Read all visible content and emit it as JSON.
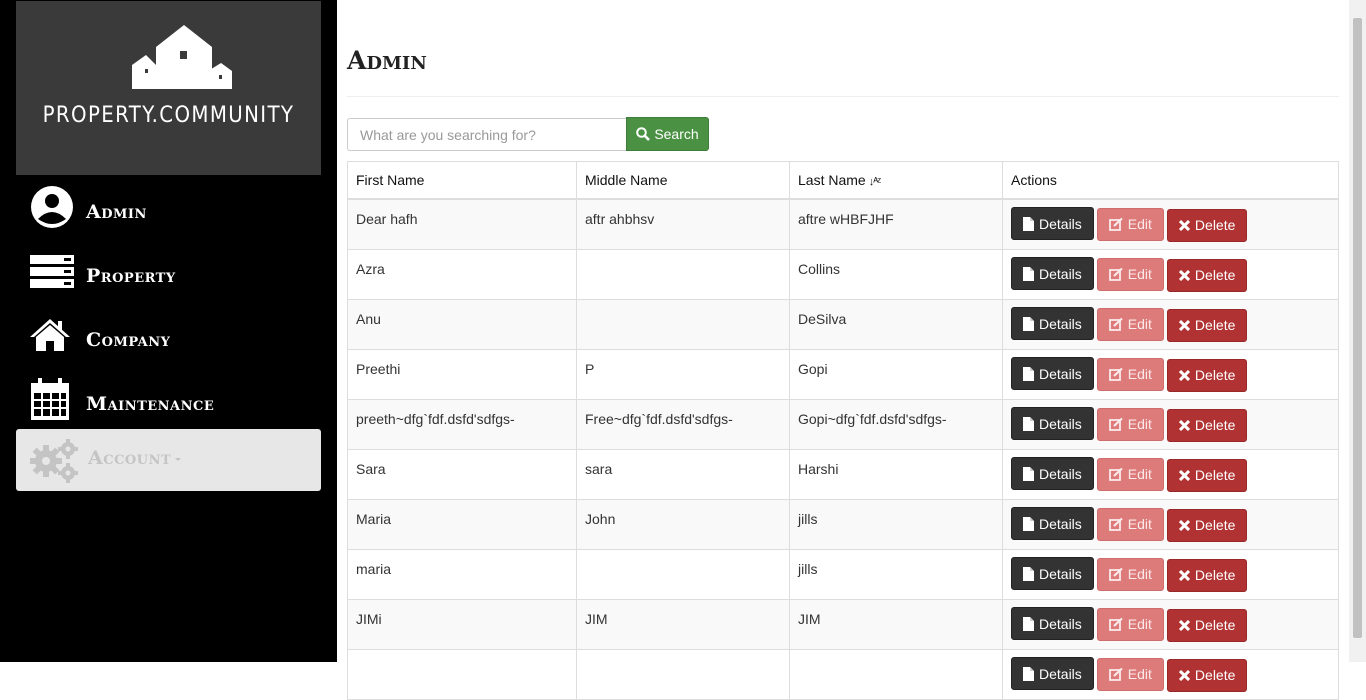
{
  "brand": {
    "logo_text": "PROPERTY.COMMUNITY"
  },
  "nav": {
    "items": [
      {
        "label": "Admin",
        "icon": "user-circle-icon"
      },
      {
        "label": "Property",
        "icon": "server-icon"
      },
      {
        "label": "Company",
        "icon": "home-icon"
      },
      {
        "label": "Maintenance",
        "icon": "calendar-icon"
      }
    ],
    "account": {
      "label": "Account",
      "icon": "gears-icon"
    }
  },
  "page": {
    "title": "Admin"
  },
  "search": {
    "placeholder": "What are you searching for?",
    "button_label": "Search"
  },
  "table": {
    "columns": [
      "First Name",
      "Middle Name",
      "Last Name",
      "Actions"
    ],
    "sort_column": "Last Name",
    "action_labels": {
      "details": "Details",
      "edit": "Edit",
      "delete": "Delete"
    },
    "rows": [
      {
        "first": "Dear hafh",
        "middle": "aftr ahbhsv",
        "last": "aftre wHBFJHF"
      },
      {
        "first": "Azra",
        "middle": "",
        "last": "Collins"
      },
      {
        "first": "Anu",
        "middle": "",
        "last": "DeSilva"
      },
      {
        "first": "Preethi",
        "middle": "P",
        "last": "Gopi"
      },
      {
        "first": "preeth~dfg`fdf.dsfd'sdfgs-",
        "middle": "Free~dfg`fdf.dsfd'sdfgs-",
        "last": "Gopi~dfg`fdf.dsfd'sdfgs-"
      },
      {
        "first": "Sara",
        "middle": "sara",
        "last": "Harshi"
      },
      {
        "first": "Maria",
        "middle": "John",
        "last": "jills"
      },
      {
        "first": "maria",
        "middle": "",
        "last": "jills"
      },
      {
        "first": "JIMi",
        "middle": "JIM",
        "last": "JIM"
      },
      {
        "first": "",
        "middle": "",
        "last": ""
      }
    ]
  },
  "colors": {
    "sidebar": "#000000",
    "logo_bg": "#3b3a3a",
    "search_button": "#4a9144",
    "details_button": "#333333",
    "edit_button": "#dd7a7a",
    "delete_button": "#b03232"
  }
}
